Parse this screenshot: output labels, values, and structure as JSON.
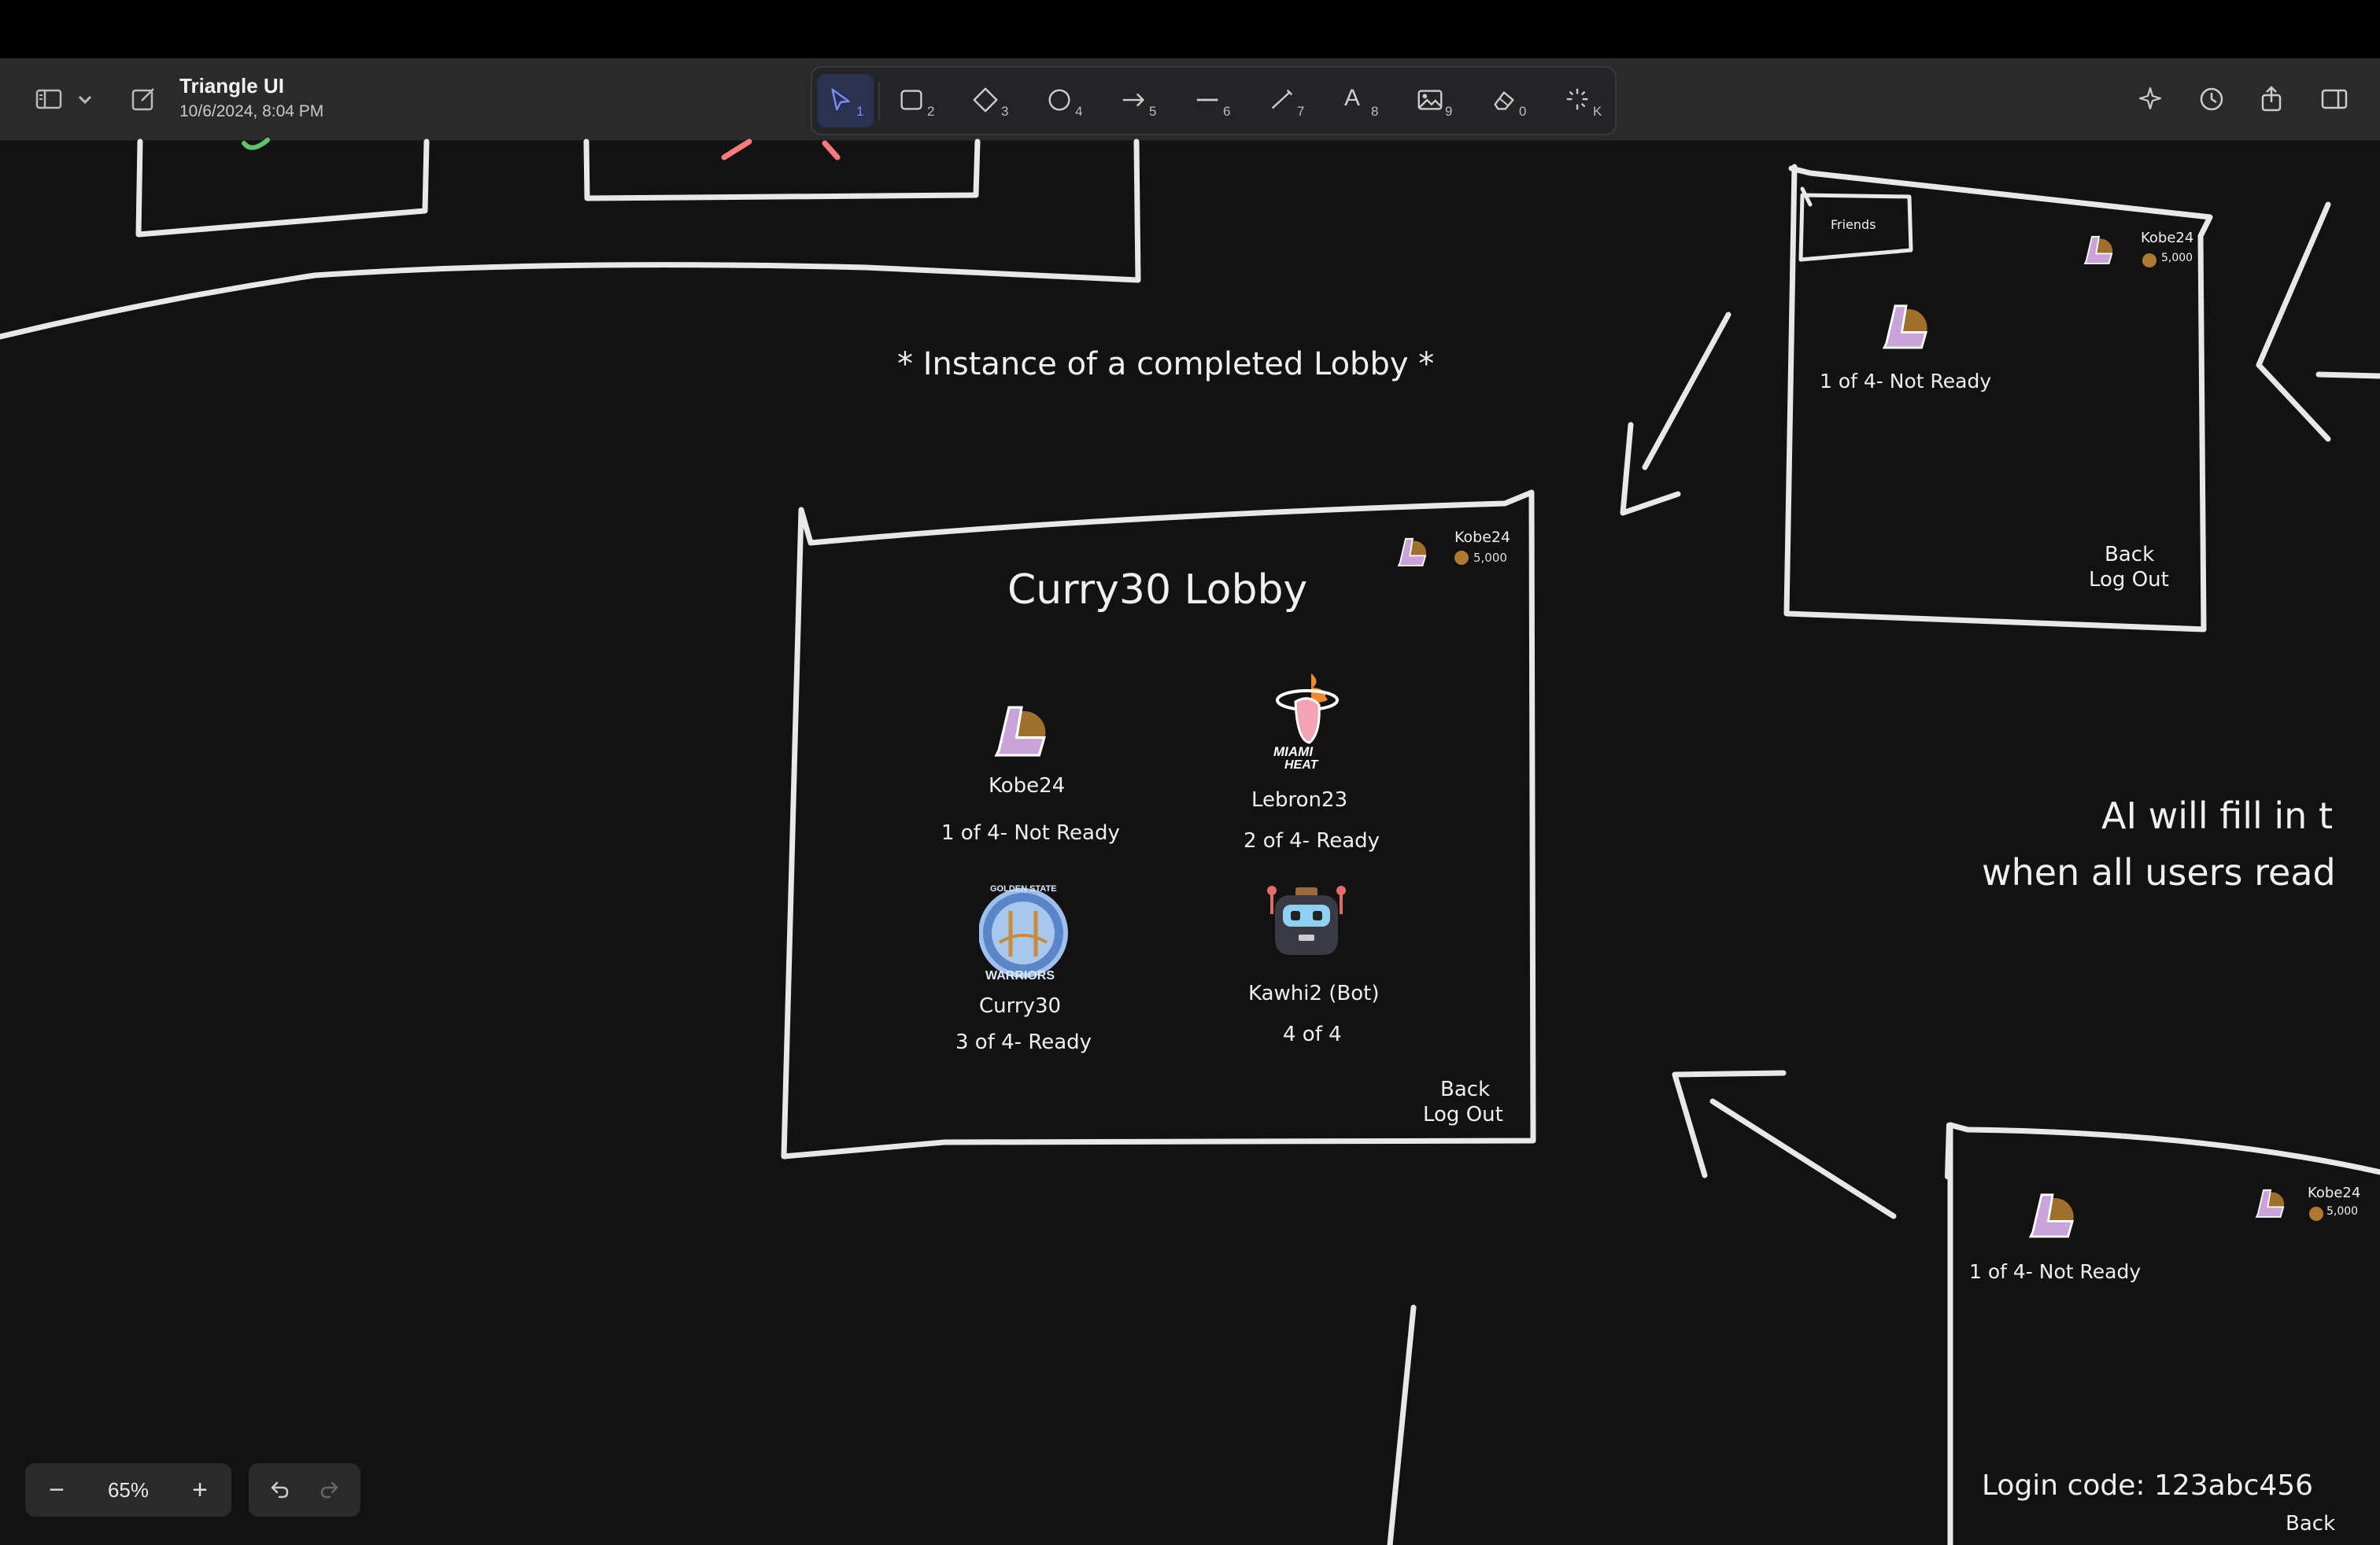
{
  "document": {
    "title": "Triangle UI",
    "date": "10/6/2024, 8:04 PM"
  },
  "toolbar": {
    "tools": [
      {
        "name": "select",
        "key": "1"
      },
      {
        "name": "rectangle",
        "key": "2"
      },
      {
        "name": "diamond",
        "key": "3"
      },
      {
        "name": "ellipse",
        "key": "4"
      },
      {
        "name": "arrow",
        "key": "5"
      },
      {
        "name": "line",
        "key": "6"
      },
      {
        "name": "draw",
        "key": "7"
      },
      {
        "name": "text",
        "key": "8"
      },
      {
        "name": "image",
        "key": "9"
      },
      {
        "name": "eraser",
        "key": "0"
      },
      {
        "name": "laser",
        "key": "K"
      }
    ],
    "text_tool_glyph": "A",
    "active_tool": "select"
  },
  "canvas": {
    "heading": "* Instance of a completed Lobby *",
    "ai_note": [
      "AI will fill in t",
      "when all users read"
    ],
    "lobby": {
      "title": "Curry30 Lobby",
      "user": "Kobe24",
      "coins": "5,000",
      "players": [
        {
          "name": "Kobe24",
          "status": "1 of 4- Not Ready",
          "logo": "lakers"
        },
        {
          "name": "Lebron23",
          "status": "2 of 4- Ready",
          "logo": "miami-heat"
        },
        {
          "name": "Curry30",
          "status": "3 of 4- Ready",
          "logo": "warriors"
        },
        {
          "name": "Kawhi2 (Bot)",
          "status": "4 of 4",
          "logo": "robot"
        }
      ],
      "back": "Back",
      "logout": "Log Out",
      "heat_text": [
        "MIAMI",
        "HEAT"
      ],
      "warriors_text": [
        "GOLDEN STATE",
        "WARRIORS"
      ]
    },
    "small_lobby": {
      "friends": "Friends",
      "user": "Kobe24",
      "coins": "5,000",
      "status": "1 of 4- Not Ready",
      "back": "Back",
      "logout": "Log Out"
    },
    "bottom_lobby": {
      "user": "Kobe24",
      "coins": "5,000",
      "status": "1 of 4- Not Ready",
      "login_code": "Login code: 123abc456",
      "back": "Back"
    }
  },
  "zoom": {
    "level": "65%",
    "minus": "−",
    "plus": "+"
  },
  "colors": {
    "background": "#121212",
    "stroke": "#e8e8e8",
    "accent": "#7d8bff",
    "lakers_purple": "#c9a3d9",
    "lakers_gold": "#b07a2e"
  }
}
